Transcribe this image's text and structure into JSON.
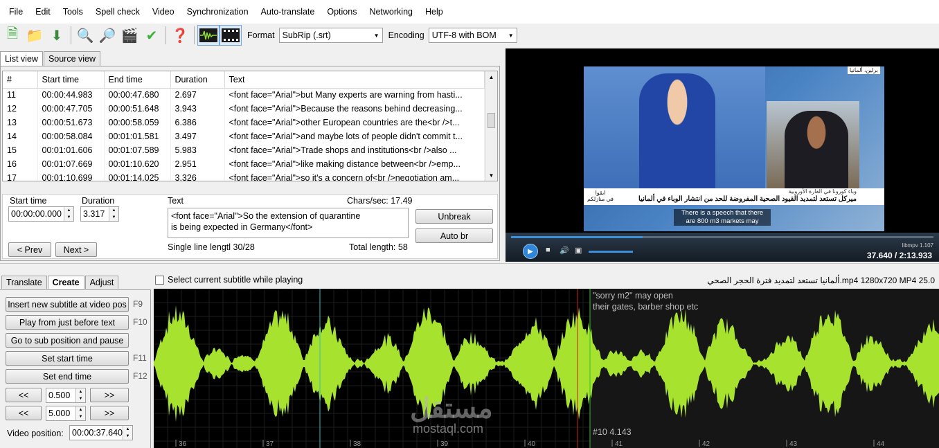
{
  "menu": [
    "File",
    "Edit",
    "Tools",
    "Spell check",
    "Video",
    "Synchronization",
    "Auto-translate",
    "Options",
    "Networking",
    "Help"
  ],
  "toolbar": {
    "format_label": "Format",
    "format_value": "SubRip (.srt)",
    "encoding_label": "Encoding",
    "encoding_value": "UTF-8 with BOM"
  },
  "view_tabs": [
    "List view",
    "Source view"
  ],
  "grid": {
    "headers": [
      "#",
      "Start time",
      "End time",
      "Duration",
      "Text"
    ],
    "rows": [
      [
        "11",
        "00:00:44.983",
        "00:00:47.680",
        "2.697",
        "<font face=\"Arial\">but Many experts are warning from hasti..."
      ],
      [
        "12",
        "00:00:47.705",
        "00:00:51.648",
        "3.943",
        "<font face=\"Arial\">Because the reasons behind decreasing..."
      ],
      [
        "13",
        "00:00:51.673",
        "00:00:58.059",
        "6.386",
        "<font face=\"Arial\">other European countries are the<br />t..."
      ],
      [
        "14",
        "00:00:58.084",
        "00:01:01.581",
        "3.497",
        "<font face=\"Arial\">and maybe lots of people didn't commit t..."
      ],
      [
        "15",
        "00:01:01.606",
        "00:01:07.589",
        "5.983",
        "<font face=\"Arial\">Trade shops and institutions<br />also ..."
      ],
      [
        "16",
        "00:01:07.669",
        "00:01:10.620",
        "2.951",
        "<font face=\"Arial\">like making distance between<br />emp..."
      ],
      [
        "17",
        "00:01:10.699",
        "00:01:14.025",
        "3.326",
        "<font face=\"Arial\">so it's a concern of<br />negotiation am..."
      ]
    ]
  },
  "editor": {
    "start_time_label": "Start time",
    "start_time_value": "00:00:00.000",
    "duration_label": "Duration",
    "duration_value": "3.317",
    "text_label": "Text",
    "chars_sec": "Chars/sec: 17.49",
    "text_line1": "<font face=\"Arial\">So the extension of quarantine",
    "text_line2": "is being expected in Germany</font>",
    "unbreak": "Unbreak",
    "auto_br": "Auto br",
    "prev": "< Prev",
    "next": "Next >",
    "single_line": "Single line lengtl 30/28",
    "total_length": "Total length: 58"
  },
  "video": {
    "city": "برلين، ألمانيا",
    "ticker_small": "وباء كورونا في القارة الأوروبية",
    "ticker_main": "ميركل تستعد لتمديد القيود الصحية المفروضة للحد من انتشار الوباء في ألمانيا",
    "logo_line1": "ابقوا",
    "logo_line2": "في منازلكم",
    "subtitle_line1": "There is a speech that there",
    "subtitle_line2": "are 800 m3 markets may",
    "player": "libmpv 1.107",
    "time": "37.640 / 2:13.933"
  },
  "bottom_tabs": [
    "Translate",
    "Create",
    "Adjust"
  ],
  "create": {
    "insert_new": "Insert new subtitle at video pos",
    "insert_key": "F9",
    "play_before": "Play from just before text",
    "play_key": "F10",
    "goto_sub": "Go to sub position and pause",
    "set_start": "Set start time",
    "set_start_key": "F11",
    "set_end": "Set end time",
    "set_end_key": "F12",
    "back": "<<",
    "forward": ">>",
    "step1": "0.500",
    "step2": "5.000",
    "video_pos_label": "Video position:",
    "video_pos_value": "00:00:37.640"
  },
  "waveform": {
    "select_current": "Select current subtitle while playing",
    "file_info": "ألمانيا تستعد لتمديد فترة الحجر الصحي.mp4 1280x720 MP4 25.0",
    "sub_line1": "\"sorry m2\" may open",
    "sub_line2": "their gates, barber shop etc",
    "sub_index": "#10  4.143",
    "ticks": [
      "36",
      "37",
      "38",
      "39",
      "40",
      "41",
      "42",
      "43",
      "44"
    ],
    "watermark": "مستقل",
    "watermark_url": "mostaql.com",
    "wave_color": "#a6e22e"
  }
}
